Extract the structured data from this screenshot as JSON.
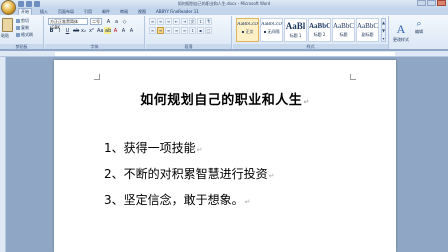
{
  "window": {
    "title": "如何规划自己的职业和人生.docx - Microsoft Word"
  },
  "ribbon": {
    "tabs": [
      "开始",
      "插入",
      "页面布局",
      "引用",
      "邮件",
      "审阅",
      "视图",
      "ABBYY FineReader 11"
    ],
    "active_tab": "开始",
    "clipboard": {
      "paste": "粘贴",
      "cut": "剪切",
      "copy": "复制",
      "format_painter": "格式刷",
      "label": "剪贴板"
    },
    "font": {
      "name": "方正正准黑简体 (GBK",
      "size": "二号",
      "label": "字体"
    },
    "paragraph": {
      "label": "段落"
    },
    "styles": {
      "label": "样式",
      "items": [
        {
          "sample": "AaBbCcDd",
          "name": "▪ 正文"
        },
        {
          "sample": "AaBbCcDd",
          "name": "▪ 无间隔"
        },
        {
          "sample": "AaBl",
          "name": "标题 1"
        },
        {
          "sample": "AaBbC",
          "name": "标题 2"
        },
        {
          "sample": "AaBbC",
          "name": "标题"
        },
        {
          "sample": "AaBbC",
          "name": "副标题"
        }
      ],
      "change_styles": "更改样式"
    },
    "editing": {
      "label": "编辑"
    }
  },
  "document": {
    "title": "如何规划自己的职业和人生",
    "items": [
      "1、获得一项技能",
      "2、不断的对积累智慧进行投资",
      "3、坚定信念，敢于想象。"
    ]
  }
}
